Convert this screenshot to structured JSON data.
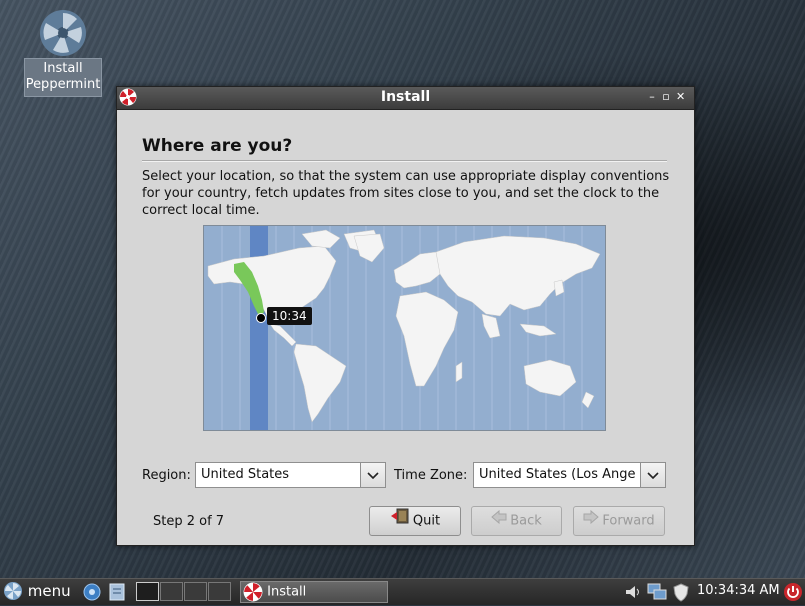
{
  "desktop": {
    "icons": [
      {
        "label_line1": "Install",
        "label_line2": "Peppermint",
        "icon": "peppermint-installer-icon"
      }
    ]
  },
  "window": {
    "title": "Install",
    "controls": [
      "minimize-icon",
      "maximize-icon",
      "close-icon"
    ]
  },
  "page": {
    "heading": "Where are you?",
    "description": "Select your location, so that the system can use appropriate display conventions for your country, fetch updates from sites close to you, and set the clock to the correct local time."
  },
  "map": {
    "time_label": "10:34",
    "colors": {
      "ocean": "#93aecf",
      "land": "#f4f4f4",
      "band": "#5f86c4",
      "selected_zone": "#79c85a"
    }
  },
  "region": {
    "label": "Region:",
    "value": "United States"
  },
  "timezone": {
    "label": "Time Zone:",
    "value": "United States (Los Ange"
  },
  "footer": {
    "step": "Step 2 of 7",
    "quit": "Quit",
    "back": "Back",
    "forward": "Forward"
  },
  "taskbar": {
    "menu_label": "menu",
    "task_label": "Install",
    "clock": "10:34:34 AM",
    "tray_icons": [
      "volume-icon",
      "network-icon",
      "shield-icon",
      "power-icon"
    ]
  }
}
